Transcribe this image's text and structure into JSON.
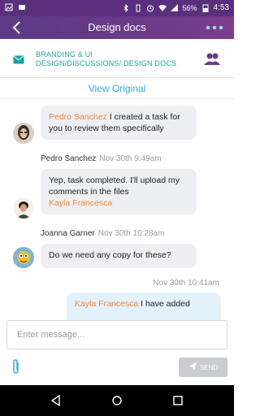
{
  "status_bar": {
    "battery": "56%",
    "time": "4:53"
  },
  "app_bar": {
    "title": "Design docs"
  },
  "breadcrumb": {
    "path": "BRANDING & UI DESIGN/DISCUSSIONS/ DESIGN DOCS"
  },
  "view_original": "View Original",
  "messages": [
    {
      "mention": "Pedro Sanchez",
      "text": " I created a task for you to review them specifically"
    },
    {
      "author": "Pedro Sanchez",
      "time": "Nov 30th 9:49am",
      "text": "Yep, task completed. I'll upload my comments in the files",
      "mention": "Kayla Francesca"
    },
    {
      "author": "Joanna Garner",
      "time": "Nov 30th 10:28am",
      "text": "Do we need any copy for these?"
    },
    {
      "time": "Nov 30th 10:41am",
      "mention": "Kayla Francesca",
      "text": " I have added"
    }
  ],
  "composer": {
    "placeholder": "Enter message...",
    "send_label": "SEND"
  },
  "colors": {
    "header_start": "#5b3a86",
    "accent_teal": "#1ba0a0",
    "link_blue": "#36a8d8",
    "mention_orange": "#f0883e"
  }
}
